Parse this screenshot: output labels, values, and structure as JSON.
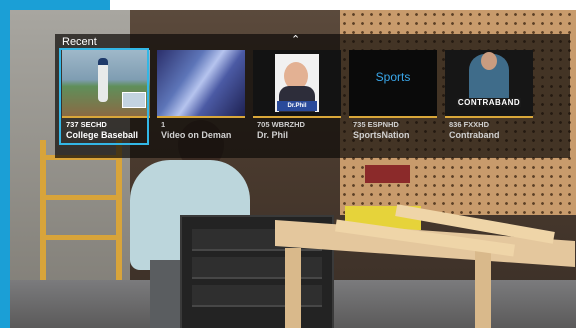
{
  "overlay": {
    "heading": "Recent",
    "collapse_icon": "chevron-up-icon",
    "tiles": [
      {
        "channel": "737 SECHD",
        "title": "College Baseball",
        "selected": true
      },
      {
        "channel": "1",
        "title": "Video on Deman",
        "selected": false
      },
      {
        "channel": "705 WBRZHD",
        "title": "Dr. Phil",
        "selected": false
      },
      {
        "channel": "735 ESPNHD",
        "title": "SportsNation",
        "selected": false
      },
      {
        "channel": "836 FXXHD",
        "title": "Contraband",
        "selected": false
      }
    ],
    "thumb_text": {
      "sports": "Sports",
      "contraband": "CONTRABAND",
      "drphil_plate": "Dr.Phil"
    }
  },
  "colors": {
    "frame": "#1b9fd6",
    "selection": "#33b7e6",
    "tile_underline": "#d9a73a"
  }
}
